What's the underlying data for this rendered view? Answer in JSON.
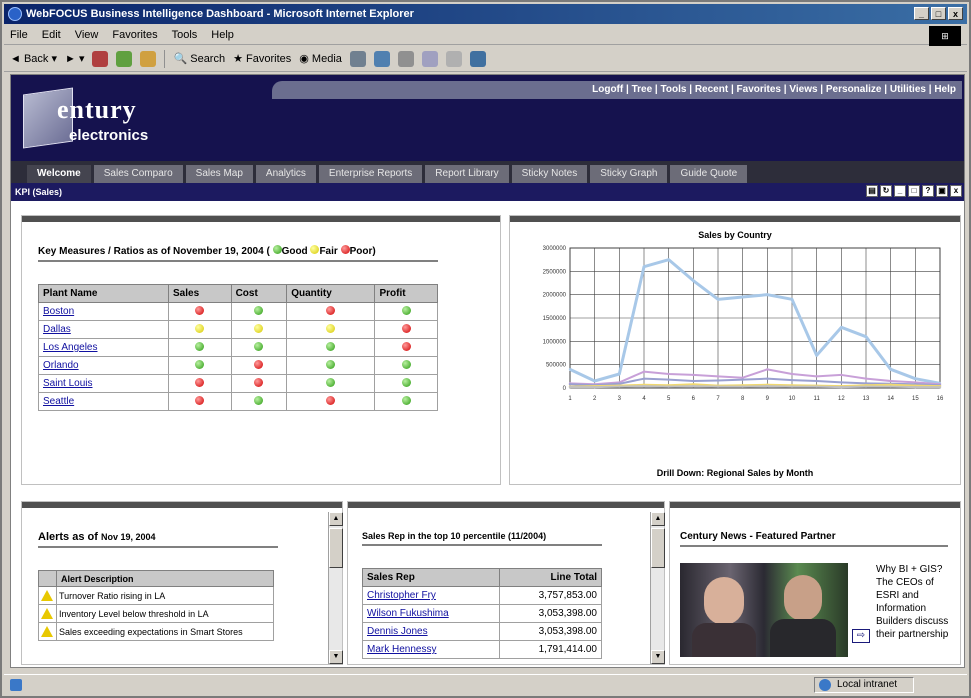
{
  "window": {
    "title": "WebFOCUS Business Intelligence Dashboard - Microsoft Internet Explorer",
    "controls": [
      "_",
      "□",
      "x"
    ],
    "menu": [
      "File",
      "Edit",
      "View",
      "Favorites",
      "Tools",
      "Help"
    ],
    "toolbar": {
      "back": "Back",
      "search": "Search",
      "favorites": "Favorites",
      "media": "Media"
    }
  },
  "header": {
    "logo_line1": "entury",
    "logo_line2": "electronics",
    "links": [
      "Logoff",
      "Tree",
      "Tools",
      "Recent",
      "Favorites",
      "Views",
      "Personalize",
      "Utilities",
      "Help"
    ]
  },
  "nav": {
    "tabs": [
      "Welcome",
      "Sales Comparo",
      "Sales Map",
      "Analytics",
      "Enterprise Reports",
      "Report Library",
      "Sticky Notes",
      "Sticky Graph",
      "Guide Quote"
    ]
  },
  "kpi_bar": {
    "label": "KPI (Sales)"
  },
  "key_measures": {
    "title": "Key Measures / Ratios as of November 19, 2004 ( ",
    "legend": [
      "Good",
      "Fair",
      "Poor"
    ],
    "columns": [
      "Plant Name",
      "Sales",
      "Cost",
      "Quantity",
      "Profit"
    ],
    "rows": [
      {
        "plant": "Boston",
        "status": [
          "red",
          "green",
          "red",
          "green"
        ]
      },
      {
        "plant": "Dallas",
        "status": [
          "yellow",
          "yellow",
          "yellow",
          "red"
        ]
      },
      {
        "plant": "Los Angeles",
        "status": [
          "green",
          "green",
          "green",
          "red"
        ]
      },
      {
        "plant": "Orlando",
        "status": [
          "green",
          "red",
          "green",
          "green"
        ]
      },
      {
        "plant": "Saint Louis",
        "status": [
          "red",
          "red",
          "green",
          "green"
        ]
      },
      {
        "plant": "Seattle",
        "status": [
          "red",
          "green",
          "red",
          "green"
        ]
      }
    ],
    "colors": {
      "red": "#d00000",
      "yellow": "#d6c800",
      "green": "#2a9a10"
    }
  },
  "chart_data": {
    "type": "line",
    "title": "Sales by Country",
    "subtitle": "Drill Down: Regional Sales by Month",
    "xlabel": "",
    "ylim": [
      0,
      3000000
    ],
    "yticks": [
      "0",
      "500000",
      "1000000",
      "1500000",
      "2000000",
      "2500000",
      "3000000"
    ],
    "x": [
      1,
      2,
      3,
      4,
      5,
      6,
      7,
      8,
      9,
      10,
      11,
      12,
      13,
      14,
      15,
      16
    ],
    "series": [
      {
        "name": "",
        "color": "#a8c8e8",
        "values": [
          400000,
          150000,
          300000,
          2600000,
          2750000,
          2300000,
          1900000,
          1950000,
          2000000,
          1900000,
          700000,
          1300000,
          1100000,
          400000,
          200000,
          100000
        ]
      },
      {
        "name": "",
        "color": "#c8a0d8",
        "values": [
          100000,
          80000,
          120000,
          350000,
          300000,
          280000,
          250000,
          220000,
          400000,
          300000,
          250000,
          280000,
          200000,
          150000,
          120000,
          80000
        ]
      },
      {
        "name": "",
        "color": "#9aa0d0",
        "values": [
          80000,
          60000,
          90000,
          200000,
          180000,
          150000,
          160000,
          180000,
          200000,
          170000,
          150000,
          120000,
          100000,
          90000,
          80000,
          60000
        ]
      },
      {
        "name": "",
        "color": "#f0d870",
        "values": [
          30000,
          40000,
          50000,
          70000,
          60000,
          80000,
          50000,
          60000,
          70000,
          60000,
          50000,
          40000,
          60000,
          70000,
          50000,
          40000
        ]
      },
      {
        "name": "",
        "color": "#c0c0c0",
        "values": [
          20000,
          20000,
          30000,
          40000,
          30000,
          40000,
          30000,
          30000,
          40000,
          30000,
          30000,
          20000,
          30000,
          30000,
          20000,
          20000
        ]
      }
    ]
  },
  "alerts": {
    "title": "Alerts as of",
    "date": "Nov 19, 2004",
    "header": "Alert Description",
    "items": [
      "Turnover Ratio rising in LA",
      "Inventory Level below threshold in LA",
      "Sales exceeding expectations in Smart Stores"
    ]
  },
  "sales_reps": {
    "title": "Sales Rep in the top 10 percentile (11/2004)",
    "columns": [
      "Sales Rep",
      "Line Total"
    ],
    "rows": [
      {
        "rep": "Christopher Fry",
        "total": "3,757,853.00"
      },
      {
        "rep": "Wilson Fukushima",
        "total": "3,053,398.00"
      },
      {
        "rep": "Dennis Jones",
        "total": "3,053,398.00"
      },
      {
        "rep": "Mark Hennessy",
        "total": "1,791,414.00"
      }
    ]
  },
  "news": {
    "title": "Century News - Featured Partner",
    "text": "Why BI + GIS? The CEOs of ESRI and Information Builders discuss their partnership"
  },
  "status": {
    "zone": "Local intranet"
  }
}
